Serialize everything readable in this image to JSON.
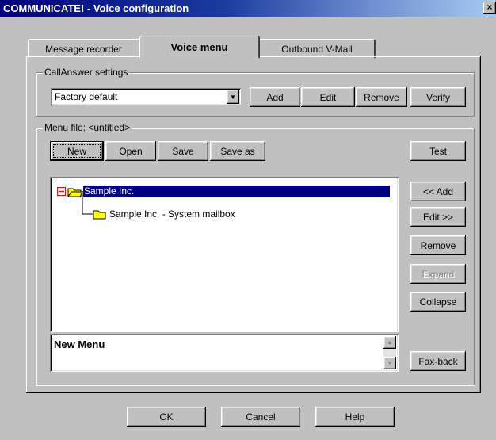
{
  "window": {
    "title": "COMMUNICATE! - Voice configuration",
    "close": "×"
  },
  "tabs": [
    {
      "label": "Message recorder"
    },
    {
      "label": "Voice menu"
    },
    {
      "label": "Outbound V-Mail"
    }
  ],
  "callanswer": {
    "label": "CallAnswer settings",
    "selected": "Factory default",
    "buttons": {
      "add": "Add",
      "edit": "Edit",
      "remove": "Remove",
      "verify": "Verify"
    }
  },
  "menufile": {
    "label": "Menu file: <untitled>",
    "buttons": {
      "new": "New",
      "open": "Open",
      "save": "Save",
      "saveas": "Save as",
      "test": "Test"
    }
  },
  "tree": {
    "root": "Sample Inc.",
    "child": "Sample Inc. - System mailbox"
  },
  "side_buttons": {
    "add": "<< Add",
    "edit": "Edit >>",
    "remove": "Remove",
    "expand": "Expand",
    "collapse": "Collapse",
    "faxback": "Fax-back"
  },
  "name_box": {
    "text": "New Menu"
  },
  "footer": {
    "ok": "OK",
    "cancel": "Cancel",
    "help": "Help"
  },
  "colors": {
    "title_start": "#000080",
    "selection": "#000080",
    "face": "#c0c0c0",
    "folder": "#ffff00",
    "collapse_box": "#ff0000"
  }
}
